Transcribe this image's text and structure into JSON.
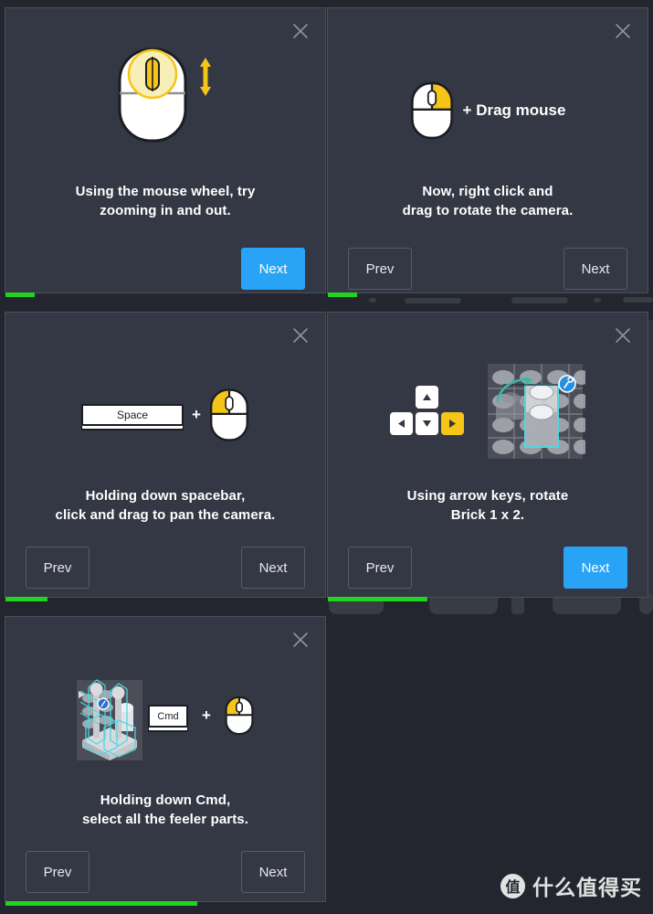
{
  "app": {
    "background_color": "#23262e",
    "panel_color": "#343744",
    "accent_blue": "#29a3f5",
    "accent_green": "#22d222",
    "accent_yellow": "#f5c518",
    "accent_cyan": "#4fd8e0"
  },
  "watermark": {
    "badge_glyph": "值",
    "text": "什么值得买"
  },
  "icons": {
    "close": "close-icon",
    "mouse": "mouse-icon",
    "scroll_arrows": "vertical-double-arrow-icon",
    "arrow_up": "arrow-up-icon",
    "arrow_down": "arrow-down-icon",
    "arrow_left": "arrow-left-icon",
    "arrow_right": "arrow-right-icon",
    "rotate": "rotate-arrow-icon",
    "wrench_badge": "wrench-badge-icon",
    "brick": "brick-icon",
    "feeler_parts": "feeler-parts-icon",
    "plus": "plus-sign"
  },
  "panels": [
    {
      "id": "panel-zoom",
      "close_label": "×",
      "caption": "Using the mouse wheel, try\nzooming in and out.",
      "art": "mouse-wheel",
      "buttons": {
        "prev": null,
        "next": "Next"
      },
      "next_style": "primary",
      "progress_percent": 9
    },
    {
      "id": "panel-rotate-camera",
      "close_label": "×",
      "art": "mouse-right-button",
      "art_label": "+ Drag mouse",
      "caption": "Now, right click and\ndrag to rotate the camera.",
      "buttons": {
        "prev": "Prev",
        "next": "Next"
      },
      "next_style": "ghost",
      "progress_percent": 9
    },
    {
      "id": "panel-pan-camera",
      "close_label": "×",
      "art": "space-plus-mouse",
      "key_label": "Space",
      "plus": "+",
      "caption": "Holding down spacebar,\nclick and drag to pan the camera.",
      "buttons": {
        "prev": "Prev",
        "next": "Next"
      },
      "next_style": "ghost",
      "progress_percent": 13
    },
    {
      "id": "panel-rotate-brick",
      "close_label": "×",
      "art": "arrow-keys-and-brick",
      "caption": "Using arrow keys, rotate\nBrick 1 x 2.",
      "buttons": {
        "prev": "Prev",
        "next": "Next"
      },
      "next_style": "primary",
      "progress_percent": 31
    },
    {
      "id": "panel-select-feeler",
      "close_label": "×",
      "art": "cmd-plus-mouse-and-parts",
      "key_label": "Cmd",
      "plus": "+",
      "caption": "Holding down Cmd,\nselect all the feeler parts.",
      "buttons": {
        "prev": "Prev",
        "next": "Next"
      },
      "next_style": "ghost",
      "progress_percent": 60
    }
  ]
}
